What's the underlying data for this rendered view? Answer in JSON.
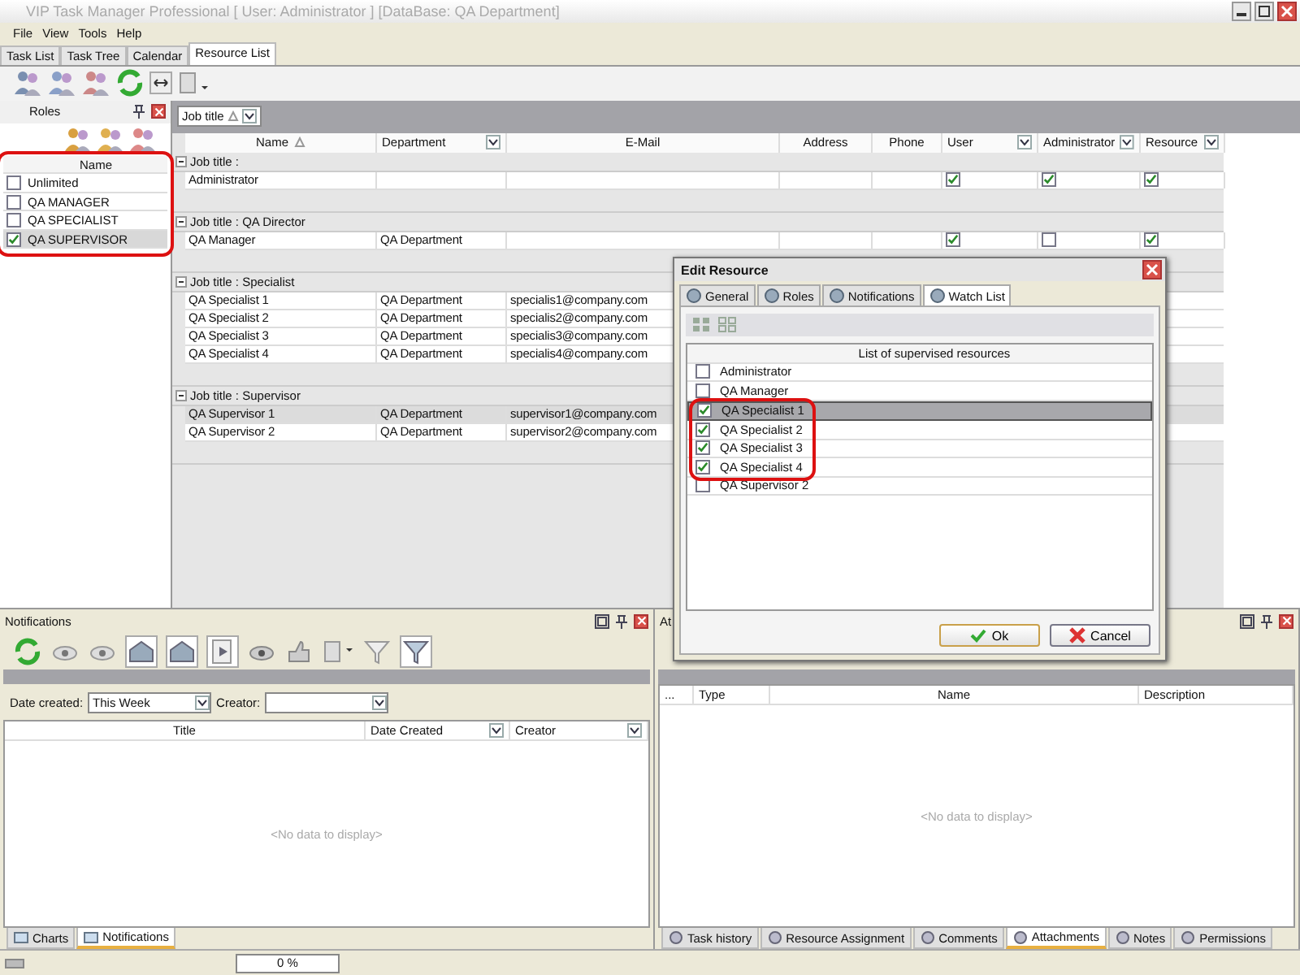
{
  "window": {
    "title": "VIP Task Manager Professional [ User: Administrator ] [DataBase: QA Department]"
  },
  "menu": [
    "File",
    "View",
    "Tools",
    "Help"
  ],
  "tabs": [
    {
      "label": "Task List",
      "selected": false
    },
    {
      "label": "Task Tree",
      "selected": false
    },
    {
      "label": "Calendar",
      "selected": false
    },
    {
      "label": "Resource List",
      "selected": true
    }
  ],
  "roles_panel": {
    "title": "Roles",
    "column": "Name",
    "items": [
      {
        "name": "Unlimited",
        "checked": false,
        "selected": false
      },
      {
        "name": "QA MANAGER",
        "checked": false,
        "selected": false
      },
      {
        "name": "QA SPECIALIST",
        "checked": false,
        "selected": false
      },
      {
        "name": "QA SUPERVISOR",
        "checked": true,
        "selected": true
      }
    ]
  },
  "grid": {
    "group_by": "Job title",
    "columns": [
      {
        "label": "Name",
        "sorted": true,
        "filter": false
      },
      {
        "label": "Department",
        "sorted": false,
        "filter": true
      },
      {
        "label": "E-Mail",
        "sorted": false,
        "filter": false
      },
      {
        "label": "Address",
        "sorted": false,
        "filter": false
      },
      {
        "label": "Phone",
        "sorted": false,
        "filter": false
      },
      {
        "label": "User",
        "sorted": false,
        "filter": true
      },
      {
        "label": "Administrator",
        "sorted": false,
        "filter": true
      },
      {
        "label": "Resource",
        "sorted": false,
        "filter": true
      }
    ],
    "groups": [
      {
        "title": "Job title :",
        "rows": [
          {
            "cells": [
              "Administrator",
              "",
              ""
            ],
            "checks": [
              true,
              true,
              true
            ],
            "selected": false
          }
        ]
      },
      {
        "title": "Job title : QA Director",
        "rows": [
          {
            "cells": [
              "QA Manager",
              "QA Department",
              ""
            ],
            "checks": [
              true,
              false,
              true
            ],
            "selected": false
          }
        ]
      },
      {
        "title": "Job title : Specialist",
        "rows": [
          {
            "cells": [
              "QA Specialist 1",
              "QA Department",
              "specialis1@company.com"
            ],
            "selected": false
          },
          {
            "cells": [
              "QA Specialist 2",
              "QA Department",
              "specialis2@company.com"
            ],
            "selected": false
          },
          {
            "cells": [
              "QA Specialist 3",
              "QA Department",
              "specialis3@company.com"
            ],
            "selected": false
          },
          {
            "cells": [
              "QA Specialist 4",
              "QA Department",
              "specialis4@company.com"
            ],
            "selected": false
          }
        ]
      },
      {
        "title": "Job title : Supervisor",
        "rows": [
          {
            "cells": [
              "QA Supervisor 1",
              "QA Department",
              "supervisor1@company.com"
            ],
            "selected": true
          },
          {
            "cells": [
              "QA Supervisor 2",
              "QA Department",
              "supervisor2@company.com"
            ],
            "selected": false
          }
        ]
      }
    ]
  },
  "notifications": {
    "title": "Notifications",
    "date_label": "Date created:",
    "date_value": "This Week",
    "creator_label": "Creator:",
    "columns": [
      "Title",
      "Date Created",
      "Creator"
    ],
    "empty": "<No data to display>",
    "tabs": [
      {
        "label": "Charts",
        "selected": false
      },
      {
        "label": "Notifications",
        "selected": true
      }
    ]
  },
  "attachments": {
    "title": "At",
    "columns": [
      "...",
      "Type",
      "Name",
      "Description"
    ],
    "empty": "<No data to display>",
    "tabs": [
      {
        "label": "Task history",
        "selected": false
      },
      {
        "label": "Resource Assignment",
        "selected": false
      },
      {
        "label": "Comments",
        "selected": false
      },
      {
        "label": "Attachments",
        "selected": true
      },
      {
        "label": "Notes",
        "selected": false
      },
      {
        "label": "Permissions",
        "selected": false
      }
    ]
  },
  "status_bar": {
    "progress": "0 %",
    "level": 0
  },
  "dialog": {
    "title": "Edit Resource",
    "tabs": [
      {
        "label": "General",
        "selected": false
      },
      {
        "label": "Roles",
        "selected": false
      },
      {
        "label": "Notifications",
        "selected": false
      },
      {
        "label": "Watch List",
        "selected": true
      }
    ],
    "column": "List of supervised resources",
    "items": [
      {
        "name": "Administrator",
        "checked": false,
        "selected": false
      },
      {
        "name": "QA Manager",
        "checked": false,
        "selected": false
      },
      {
        "name": "QA Specialist 1",
        "checked": true,
        "selected": true
      },
      {
        "name": "QA Specialist 2",
        "checked": true,
        "selected": false
      },
      {
        "name": "QA Specialist 3",
        "checked": true,
        "selected": false
      },
      {
        "name": "QA Specialist 4",
        "checked": true,
        "selected": false
      },
      {
        "name": "QA Supervisor 2",
        "checked": false,
        "selected": false
      }
    ],
    "buttons": [
      {
        "label": "Ok",
        "kind": "ok"
      },
      {
        "label": "Cancel",
        "kind": "cancel"
      }
    ]
  }
}
